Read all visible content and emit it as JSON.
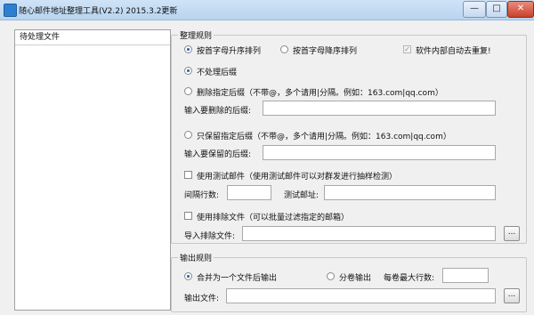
{
  "window": {
    "title": "随心邮件地址整理工具(V2.2)  2015.3.2更新",
    "minimize_icon": "minimize-icon",
    "maximize_icon": "maximize-icon",
    "close_icon": "close-icon",
    "minimize_glyph": "—",
    "maximize_glyph": "□",
    "close_glyph": "✕"
  },
  "pending_files": {
    "header": "待处理文件"
  },
  "rules": {
    "group_title": "整理规则",
    "sort_asc": "按首字母升序排列",
    "sort_desc": "按首字母降序排列",
    "auto_dedupe": "软件内部自动去重复!",
    "no_suffix": "不处理后缀",
    "delete_suffix": "删除指定后缀（不带@，多个请用|分隔。例如：163.com|qq.com）",
    "delete_suffix_input_label": "输入要删除的后缀:",
    "delete_suffix_input_value": "",
    "keep_suffix": "只保留指定后缀（不带@，多个请用|分隔。例如：163.com|qq.com）",
    "keep_suffix_input_label": "输入要保留的后缀:",
    "keep_suffix_input_value": "",
    "use_test_email": "使用测试邮件（使用测试邮件可以对群发进行抽样检测）",
    "interval_label": "间隔行数:",
    "interval_value": "",
    "test_email_label": "测试邮址:",
    "test_email_value": "",
    "use_exclude_file": "使用排除文件（可以批量过滤指定的邮箱）",
    "import_exclude_label": "导入排除文件:",
    "import_exclude_value": "",
    "browse_label": "..."
  },
  "output": {
    "group_title": "输出规则",
    "merge_output": "合并为一个文件后输出",
    "split_output": "分卷输出",
    "max_lines_label": "每卷最大行数:",
    "max_lines_value": "",
    "output_file_label": "输出文件:",
    "output_file_value": "",
    "browse_label": "..."
  },
  "state": {
    "sort": "asc",
    "suffix_mode": "none",
    "output_mode": "merge",
    "auto_dedupe_checked": true,
    "use_test_email": false,
    "use_exclude_file": false
  }
}
